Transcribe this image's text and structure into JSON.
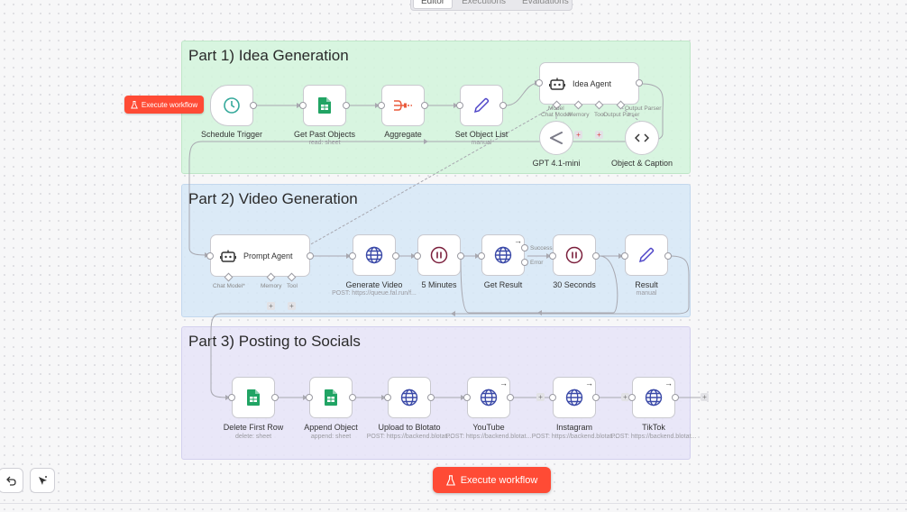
{
  "tabs": [
    {
      "label": "Editor",
      "active": true
    },
    {
      "label": "Executions",
      "active": false
    },
    {
      "label": "Evaluations",
      "active": false
    }
  ],
  "sections": {
    "part1": {
      "title": "Part 1) Idea Generation",
      "color": "#d2f5dc"
    },
    "part2": {
      "title": "Part 2) Video Generation",
      "color": "#d6e7f7"
    },
    "part3": {
      "title": "Part 3) Posting to Socials",
      "color": "#e6e4f8"
    }
  },
  "buttons": {
    "execute_small": "Execute workflow",
    "execute_main": "Execute workflow",
    "accent": "#ff4b35"
  },
  "nodes": {
    "schedule_trigger": {
      "label": "Schedule Trigger",
      "icon": "clock-icon"
    },
    "get_past_objects": {
      "label": "Get Past Objects",
      "sub": "read: sheet",
      "icon": "google-sheets-icon"
    },
    "aggregate": {
      "label": "Aggregate",
      "icon": "aggregate-icon"
    },
    "set_object_list": {
      "label": "Set Object List",
      "sub": "manual",
      "icon": "pencil-icon"
    },
    "idea_agent": {
      "label": "Idea Agent",
      "icon": "robot-icon",
      "ports": {
        "model": "Model",
        "chat_model": "Chat Model",
        "memory": "Memory",
        "tool": "Tool",
        "output_parser": "Output Parser",
        "output_parser_top": "Output Parser"
      }
    },
    "gpt_41_mini": {
      "label": "GPT 4.1-mini",
      "icon": "openai-icon"
    },
    "object_caption": {
      "label": "Object & Caption",
      "icon": "code-icon"
    },
    "prompt_agent": {
      "label": "Prompt Agent",
      "icon": "robot-icon",
      "ports": {
        "chat_model": "Chat Model*",
        "memory": "Memory",
        "tool": "Tool"
      }
    },
    "generate_video": {
      "label": "Generate Video",
      "sub": "POST: https://queue.fal.run/f...",
      "icon": "globe-icon"
    },
    "five_minutes": {
      "label": "5 Minutes",
      "icon": "pause-icon"
    },
    "get_result": {
      "label": "Get Result",
      "icon": "globe-icon",
      "outputs": {
        "success": "Success",
        "error": "Error"
      }
    },
    "thirty_seconds": {
      "label": "30 Seconds",
      "icon": "pause-icon"
    },
    "result": {
      "label": "Result",
      "sub": "manual",
      "icon": "pencil-icon"
    },
    "delete_first_row": {
      "label": "Delete First Row",
      "sub": "delete: sheet",
      "icon": "google-sheets-icon"
    },
    "append_object": {
      "label": "Append Object",
      "sub": "append: sheet",
      "icon": "google-sheets-icon"
    },
    "upload_blotato": {
      "label": "Upload to Blotato",
      "sub": "POST: https://backend.blotat...",
      "icon": "globe-icon"
    },
    "youtube": {
      "label": "YouTube",
      "sub": "POST: https://backend.blotat...",
      "icon": "globe-icon"
    },
    "instagram": {
      "label": "Instagram",
      "sub": "POST: https://backend.blotat...",
      "icon": "globe-icon"
    },
    "tiktok": {
      "label": "TikTok",
      "sub": "POST: https://backend.blotat...",
      "icon": "globe-icon"
    }
  },
  "toolbar": {
    "undo_icon": "undo-icon",
    "tidy_icon": "cursor-sparkle-icon"
  }
}
